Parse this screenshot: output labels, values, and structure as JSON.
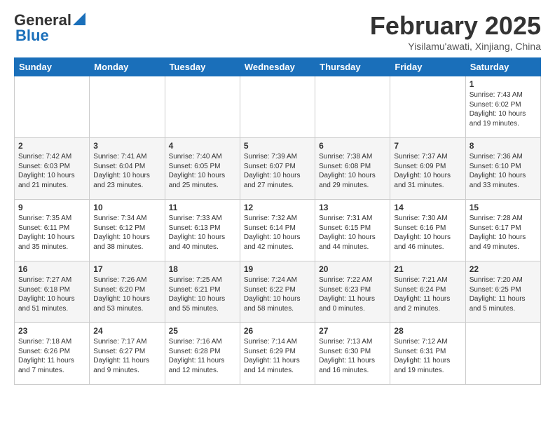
{
  "header": {
    "logo_general": "General",
    "logo_blue": "Blue",
    "month_title": "February 2025",
    "subtitle": "Yisilamu'awati, Xinjiang, China"
  },
  "weekdays": [
    "Sunday",
    "Monday",
    "Tuesday",
    "Wednesday",
    "Thursday",
    "Friday",
    "Saturday"
  ],
  "weeks": [
    [
      {
        "day": "",
        "info": ""
      },
      {
        "day": "",
        "info": ""
      },
      {
        "day": "",
        "info": ""
      },
      {
        "day": "",
        "info": ""
      },
      {
        "day": "",
        "info": ""
      },
      {
        "day": "",
        "info": ""
      },
      {
        "day": "1",
        "info": "Sunrise: 7:43 AM\nSunset: 6:02 PM\nDaylight: 10 hours\nand 19 minutes."
      }
    ],
    [
      {
        "day": "2",
        "info": "Sunrise: 7:42 AM\nSunset: 6:03 PM\nDaylight: 10 hours\nand 21 minutes."
      },
      {
        "day": "3",
        "info": "Sunrise: 7:41 AM\nSunset: 6:04 PM\nDaylight: 10 hours\nand 23 minutes."
      },
      {
        "day": "4",
        "info": "Sunrise: 7:40 AM\nSunset: 6:05 PM\nDaylight: 10 hours\nand 25 minutes."
      },
      {
        "day": "5",
        "info": "Sunrise: 7:39 AM\nSunset: 6:07 PM\nDaylight: 10 hours\nand 27 minutes."
      },
      {
        "day": "6",
        "info": "Sunrise: 7:38 AM\nSunset: 6:08 PM\nDaylight: 10 hours\nand 29 minutes."
      },
      {
        "day": "7",
        "info": "Sunrise: 7:37 AM\nSunset: 6:09 PM\nDaylight: 10 hours\nand 31 minutes."
      },
      {
        "day": "8",
        "info": "Sunrise: 7:36 AM\nSunset: 6:10 PM\nDaylight: 10 hours\nand 33 minutes."
      }
    ],
    [
      {
        "day": "9",
        "info": "Sunrise: 7:35 AM\nSunset: 6:11 PM\nDaylight: 10 hours\nand 35 minutes."
      },
      {
        "day": "10",
        "info": "Sunrise: 7:34 AM\nSunset: 6:12 PM\nDaylight: 10 hours\nand 38 minutes."
      },
      {
        "day": "11",
        "info": "Sunrise: 7:33 AM\nSunset: 6:13 PM\nDaylight: 10 hours\nand 40 minutes."
      },
      {
        "day": "12",
        "info": "Sunrise: 7:32 AM\nSunset: 6:14 PM\nDaylight: 10 hours\nand 42 minutes."
      },
      {
        "day": "13",
        "info": "Sunrise: 7:31 AM\nSunset: 6:15 PM\nDaylight: 10 hours\nand 44 minutes."
      },
      {
        "day": "14",
        "info": "Sunrise: 7:30 AM\nSunset: 6:16 PM\nDaylight: 10 hours\nand 46 minutes."
      },
      {
        "day": "15",
        "info": "Sunrise: 7:28 AM\nSunset: 6:17 PM\nDaylight: 10 hours\nand 49 minutes."
      }
    ],
    [
      {
        "day": "16",
        "info": "Sunrise: 7:27 AM\nSunset: 6:18 PM\nDaylight: 10 hours\nand 51 minutes."
      },
      {
        "day": "17",
        "info": "Sunrise: 7:26 AM\nSunset: 6:20 PM\nDaylight: 10 hours\nand 53 minutes."
      },
      {
        "day": "18",
        "info": "Sunrise: 7:25 AM\nSunset: 6:21 PM\nDaylight: 10 hours\nand 55 minutes."
      },
      {
        "day": "19",
        "info": "Sunrise: 7:24 AM\nSunset: 6:22 PM\nDaylight: 10 hours\nand 58 minutes."
      },
      {
        "day": "20",
        "info": "Sunrise: 7:22 AM\nSunset: 6:23 PM\nDaylight: 11 hours\nand 0 minutes."
      },
      {
        "day": "21",
        "info": "Sunrise: 7:21 AM\nSunset: 6:24 PM\nDaylight: 11 hours\nand 2 minutes."
      },
      {
        "day": "22",
        "info": "Sunrise: 7:20 AM\nSunset: 6:25 PM\nDaylight: 11 hours\nand 5 minutes."
      }
    ],
    [
      {
        "day": "23",
        "info": "Sunrise: 7:18 AM\nSunset: 6:26 PM\nDaylight: 11 hours\nand 7 minutes."
      },
      {
        "day": "24",
        "info": "Sunrise: 7:17 AM\nSunset: 6:27 PM\nDaylight: 11 hours\nand 9 minutes."
      },
      {
        "day": "25",
        "info": "Sunrise: 7:16 AM\nSunset: 6:28 PM\nDaylight: 11 hours\nand 12 minutes."
      },
      {
        "day": "26",
        "info": "Sunrise: 7:14 AM\nSunset: 6:29 PM\nDaylight: 11 hours\nand 14 minutes."
      },
      {
        "day": "27",
        "info": "Sunrise: 7:13 AM\nSunset: 6:30 PM\nDaylight: 11 hours\nand 16 minutes."
      },
      {
        "day": "28",
        "info": "Sunrise: 7:12 AM\nSunset: 6:31 PM\nDaylight: 11 hours\nand 19 minutes."
      },
      {
        "day": "",
        "info": ""
      }
    ]
  ]
}
